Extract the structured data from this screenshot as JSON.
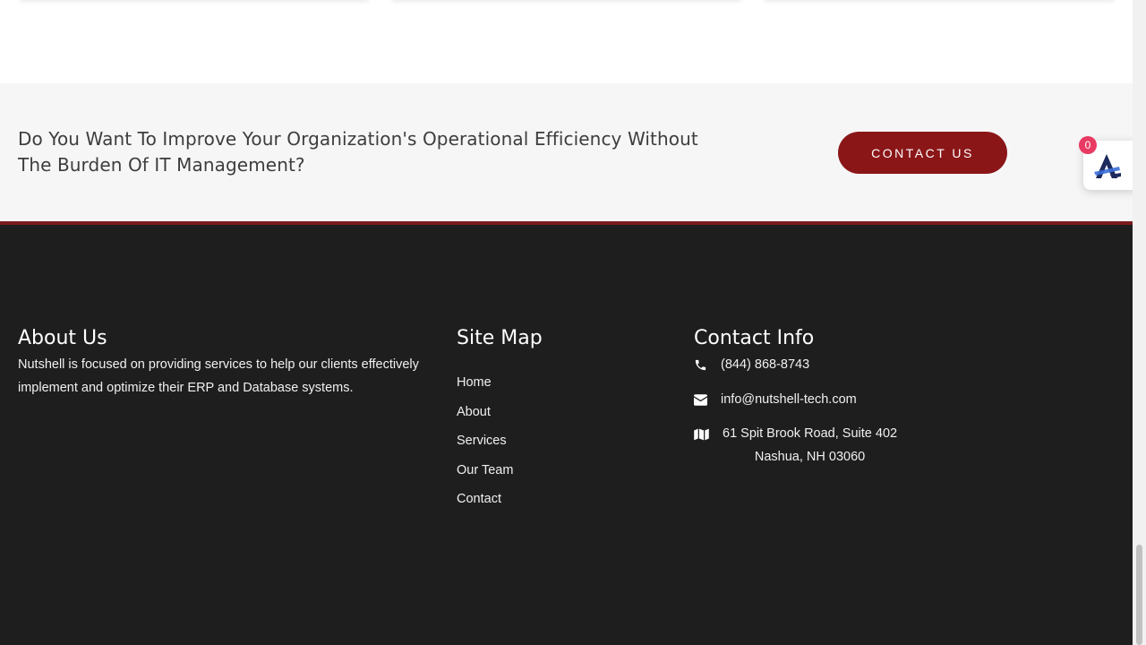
{
  "cta": {
    "heading": "Do You Want To Improve Your Organization's Operational Efficiency Without The Burden Of IT Management?",
    "button_label": "CONTACT US",
    "accent_color": "#8a1618"
  },
  "footer": {
    "about": {
      "title": "About Us",
      "text": "Nutshell is focused on providing services to help our clients effectively implement and optimize their ERP and Database systems."
    },
    "sitemap": {
      "title": "Site Map",
      "items": [
        {
          "label": "Home"
        },
        {
          "label": "About"
        },
        {
          "label": "Services"
        },
        {
          "label": "Our Team"
        },
        {
          "label": "Contact"
        }
      ]
    },
    "contact": {
      "title": "Contact Info",
      "phone": "(844) 868-8743",
      "email": "info@nutshell-tech.com",
      "address_line1": "61 Spit Brook Road, Suite 402",
      "address_line2": "Nashua, NH 03060",
      "icons": [
        "phone-icon",
        "envelope-icon",
        "map-icon"
      ]
    },
    "background_color": "#1e1e1e"
  },
  "widget": {
    "badge_count": "0",
    "icon": "accessibility-widget-icon",
    "badge_color": "#e83a63"
  }
}
